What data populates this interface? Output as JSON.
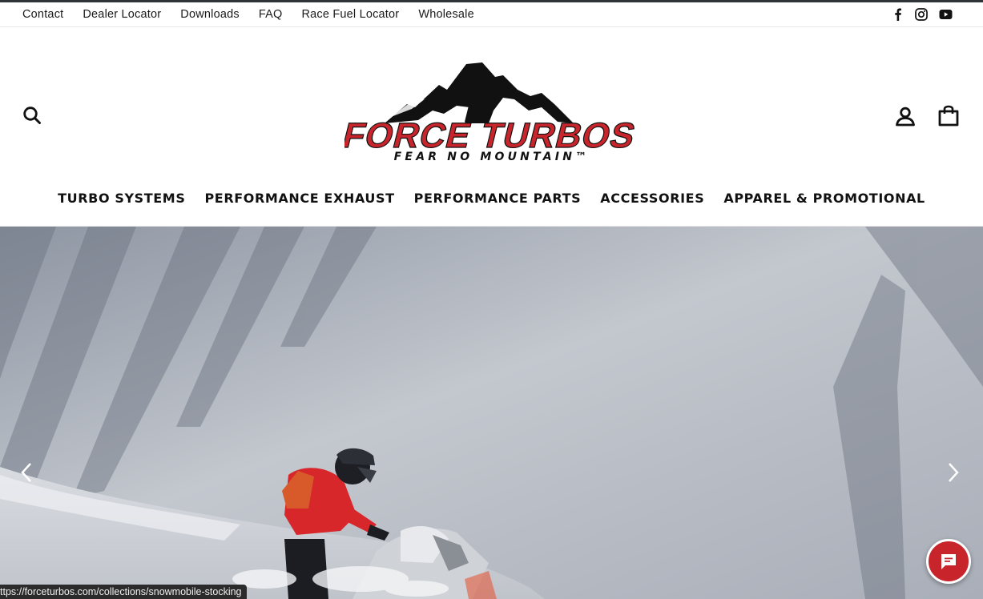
{
  "utility_nav": {
    "links": [
      "Contact",
      "Dealer Locator",
      "Downloads",
      "FAQ",
      "Race Fuel Locator",
      "Wholesale"
    ],
    "social": [
      "facebook-icon",
      "instagram-icon",
      "youtube-icon"
    ]
  },
  "header": {
    "logo_text": "FORCE TURBOS",
    "logo_tagline": "FEAR NO MOUNTAIN™",
    "icons": [
      "search-icon",
      "account-icon",
      "cart-icon"
    ]
  },
  "main_nav": {
    "items": [
      "TURBO SYSTEMS",
      "PERFORMANCE EXHAUST",
      "PERFORMANCE PARTS",
      "ACCESSORIES",
      "APPAREL & PROMOTIONAL"
    ]
  },
  "hero": {
    "controls": [
      "chevron-left-icon",
      "chevron-right-icon"
    ]
  },
  "chat": {
    "icon": "chat-icon",
    "color": "#c8242b"
  },
  "status_bar": {
    "url": "ttps://forceturbos.com/collections/snowmobile-stocking"
  },
  "colors": {
    "brand_red": "#c8242b",
    "text": "#111111",
    "topline": "#2f3438"
  }
}
